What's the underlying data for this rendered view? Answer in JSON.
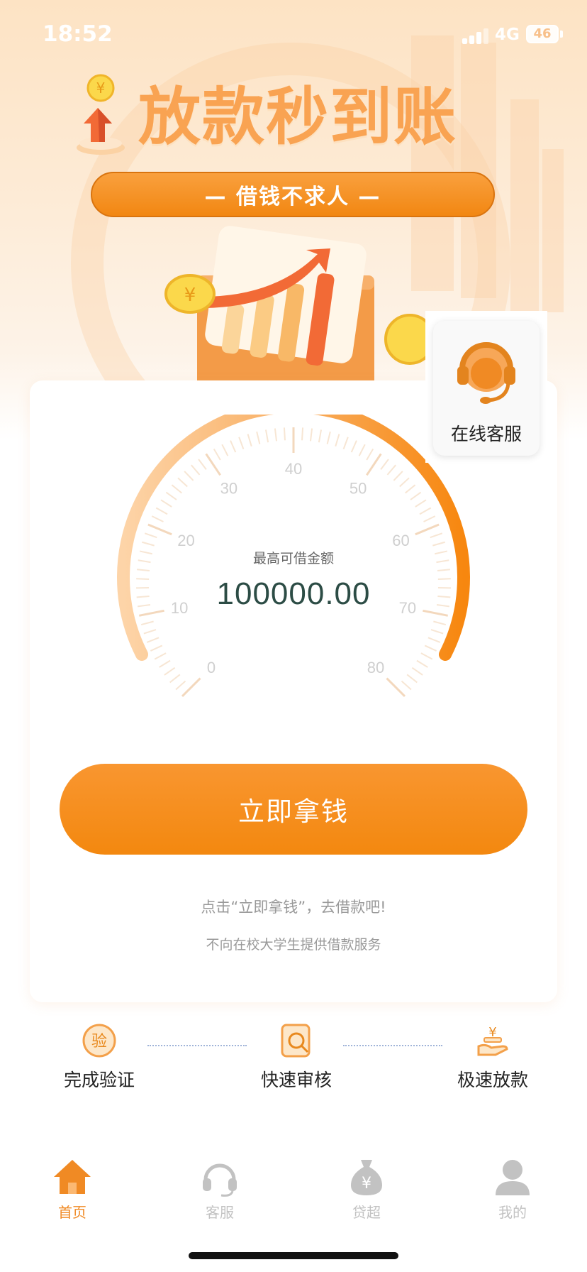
{
  "status_bar": {
    "time": "18:52",
    "network": "4G",
    "battery": "46"
  },
  "hero": {
    "headline": "放款秒到账",
    "slogan": "— 借钱不求人 —",
    "coin_symbol": "¥"
  },
  "gauge": {
    "caption": "最高可借金额",
    "amount": "100000.00",
    "ticks": [
      "0",
      "10",
      "20",
      "30",
      "40",
      "50",
      "60",
      "70",
      "80"
    ]
  },
  "cta": {
    "label": "立即拿钱"
  },
  "hint": "点击“立即拿钱”，去借款吧!",
  "disclaimer": "不向在校大学生提供借款服务",
  "customer_service": {
    "label": "在线客服"
  },
  "steps": [
    {
      "label": "完成验证",
      "icon_text": "验",
      "icon": "verify-icon"
    },
    {
      "label": "快速审核",
      "icon": "review-icon"
    },
    {
      "label": "极速放款",
      "icon_text": "¥",
      "icon": "payout-icon"
    }
  ],
  "tabs": [
    {
      "label": "首页",
      "icon": "home-icon",
      "active": true
    },
    {
      "label": "客服",
      "icon": "headset-icon",
      "active": false
    },
    {
      "label": "贷超",
      "icon_text": "¥",
      "icon": "money-bag-icon",
      "active": false
    },
    {
      "label": "我的",
      "icon": "user-icon",
      "active": false
    }
  ],
  "colors": {
    "brand_orange": "#f3880f",
    "amount_text": "#2c4c45",
    "active_tab": "#f08a24",
    "inactive_tab": "#c2c2c2"
  }
}
